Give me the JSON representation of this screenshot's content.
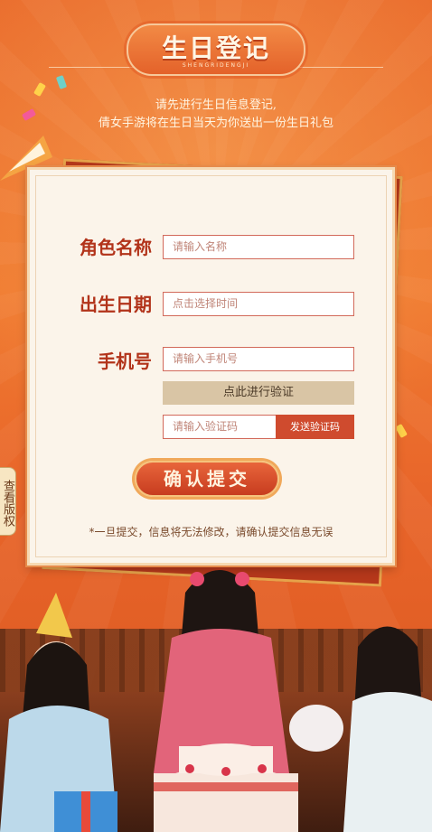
{
  "header": {
    "title": "生日登记",
    "subtitle": "SHENGRIDENGJI"
  },
  "intro": {
    "line1": "请先进行生日信息登记,",
    "line2": "倩女手游将在生日当天为你送出一份生日礼包"
  },
  "form": {
    "role_name": {
      "label": "角色名称",
      "placeholder": "请输入名称"
    },
    "birthday": {
      "label": "出生日期",
      "placeholder": "点击选择时间"
    },
    "phone": {
      "label": "手机号",
      "placeholder": "请输入手机号"
    },
    "verify_button": "点此进行验证",
    "code": {
      "placeholder": "请输入验证码"
    },
    "send_code_button": "发送验证码",
    "submit_button": "确认提交",
    "notice": "*一旦提交，信息将无法修改，请确认提交信息无误"
  },
  "side_tab": {
    "label": "查看版权"
  },
  "colors": {
    "background": "#e9692a",
    "card": "#fbf4ea",
    "label": "#b2331a",
    "send_button": "#cf4b2e",
    "verify_bar": "#d9c5a5"
  }
}
